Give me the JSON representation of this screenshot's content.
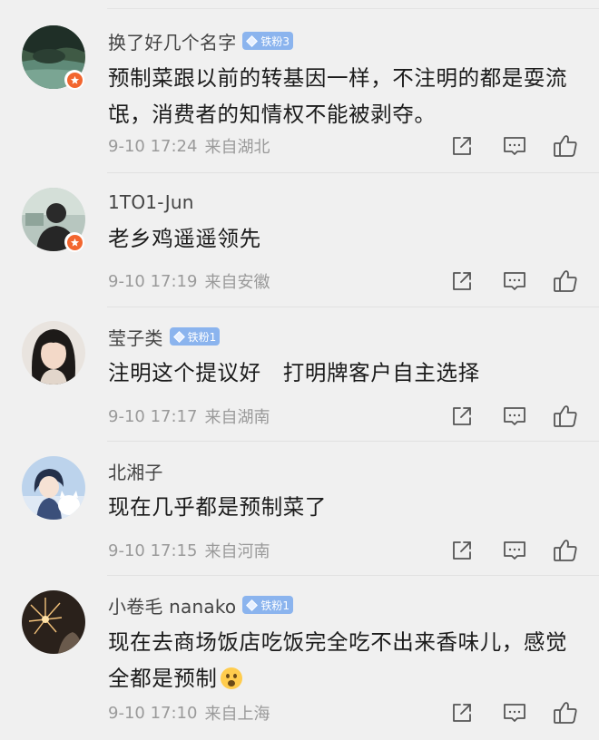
{
  "comments": [
    {
      "username": "换了好几个名字",
      "fan_badge": "铁粉3",
      "has_badge": true,
      "text": "预制菜跟以前的转基因一样，不注明的都是耍流氓，消费者的知情权不能被剥夺。",
      "time": "9-10 17:24",
      "location": "来自湖北",
      "verified": true
    },
    {
      "username": "1TO1-Jun",
      "fan_badge": "",
      "has_badge": false,
      "text": "老乡鸡遥遥领先",
      "time": "9-10 17:19",
      "location": "来自安徽",
      "verified": true
    },
    {
      "username": "莹子类",
      "fan_badge": "铁粉1",
      "has_badge": true,
      "text": "注明这个提议好　打明牌客户自主选择",
      "time": "9-10 17:17",
      "location": "来自湖南",
      "verified": false
    },
    {
      "username": "北湘子",
      "fan_badge": "",
      "has_badge": false,
      "text": "现在几乎都是预制菜了",
      "time": "9-10 17:15",
      "location": "来自河南",
      "verified": false
    },
    {
      "username": "小卷毛 nanako",
      "fan_badge": "铁粉1",
      "has_badge": true,
      "text": "现在去商场饭店吃饭完全吃不出来香味儿，感觉全都是预制",
      "emoji": "astonished-emoji",
      "time": "9-10 17:10",
      "location": "来自上海",
      "verified": false
    }
  ],
  "icons": {
    "share": "share-icon",
    "comment": "comment-icon",
    "like": "like-icon"
  },
  "colors": {
    "background": "#f0f0f0",
    "fan_badge": "#8bb4ee",
    "verified_badge": "#f2662f",
    "meta_text": "#9a9a9a"
  }
}
